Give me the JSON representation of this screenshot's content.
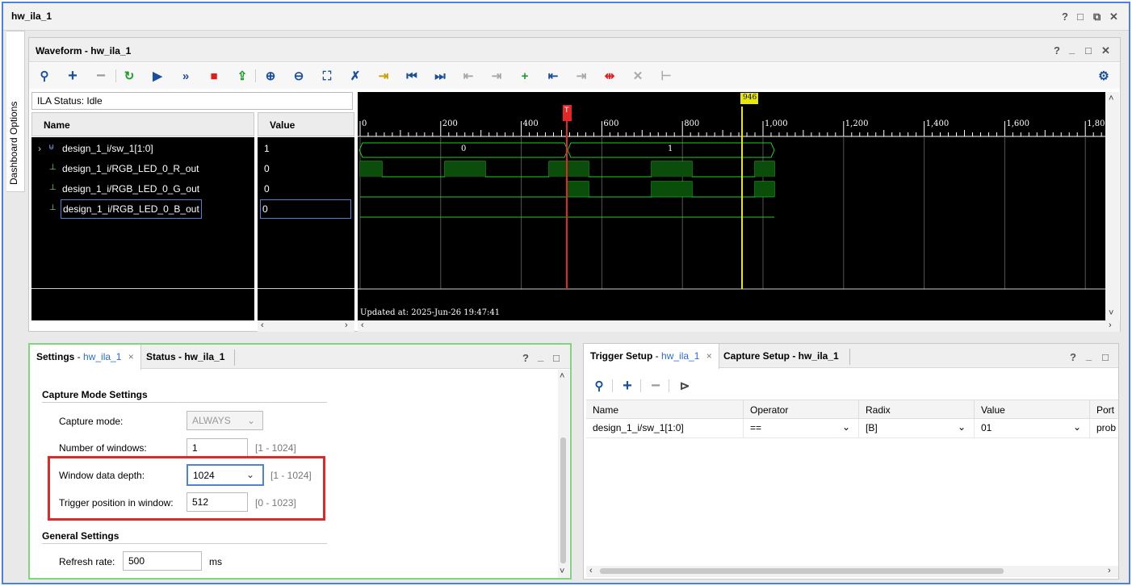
{
  "window": {
    "title": "hw_ila_1",
    "ctl_help": "?",
    "ctl_restore": "□",
    "ctl_float": "⧉",
    "ctl_close": "✕"
  },
  "side_tab": {
    "label": "Dashboard Options"
  },
  "waveform": {
    "title": "Waveform - hw_ila_1",
    "ctl_help": "?",
    "ctl_min": "_",
    "ctl_max": "□",
    "ctl_close": "✕",
    "ila_status": "ILA Status: Idle",
    "col_name": "Name",
    "col_value": "Value",
    "signals": [
      {
        "name": "design_1_i/sw_1[1:0]",
        "value": "1",
        "expand": "›",
        "icon": "bus-icon"
      },
      {
        "name": "design_1_i/RGB_LED_0_R_out",
        "value": "0",
        "icon": "wire-icon"
      },
      {
        "name": "design_1_i/RGB_LED_0_G_out",
        "value": "0",
        "icon": "wire-icon"
      },
      {
        "name": "design_1_i/RGB_LED_0_B_out",
        "value": "0",
        "icon": "wire-icon"
      }
    ],
    "ruler_labels": [
      "0",
      "200",
      "400",
      "600",
      "800",
      "1,000",
      "1,200",
      "1,400",
      "1,600",
      "1,80"
    ],
    "trigger_marker": "T",
    "cursor_label": "946",
    "bus_values": [
      "0",
      "1"
    ],
    "updated": "Updated at: 2025-Jun-26 19:47:41",
    "scroll_left": "‹",
    "scroll_right": "›",
    "scroll_up": "˄",
    "scroll_down": "˅"
  },
  "settings": {
    "tab_active_prefix": "Settings",
    "tab_active_suffix": "hw_ila_1",
    "tab_active_sep": " - ",
    "tab_close": "×",
    "tab_status": "Status - hw_ila_1",
    "ctl_help": "?",
    "ctl_min": "_",
    "ctl_max": "□",
    "capture_heading": "Capture Mode Settings",
    "capture_mode_label": "Capture mode:",
    "capture_mode_value": "ALWAYS",
    "num_windows_label": "Number of windows:",
    "num_windows_value": "1",
    "num_windows_range": "[1 - 1024]",
    "depth_label": "Window data depth:",
    "depth_value": "1024",
    "depth_range": "[1 - 1024]",
    "trigpos_label": "Trigger position in window:",
    "trigpos_value": "512",
    "trigpos_range": "[0 - 1023]",
    "general_heading": "General Settings",
    "refresh_label": "Refresh rate:",
    "refresh_value": "500",
    "refresh_unit": "ms"
  },
  "trigger": {
    "tab_active_prefix": "Trigger Setup",
    "tab_active_sep": " - ",
    "tab_active_suffix": "hw_ila_1",
    "tab_close": "×",
    "tab_capture": "Capture Setup - hw_ila_1",
    "ctl_help": "?",
    "ctl_min": "_",
    "ctl_max": "□",
    "columns": [
      "Name",
      "Operator",
      "Radix",
      "Value",
      "Port"
    ],
    "row": {
      "name": "design_1_i/sw_1[1:0]",
      "operator": "==",
      "radix": "[B]",
      "value": "01",
      "port": "prob"
    }
  },
  "colors": {
    "accent": "#4d82d6",
    "highlight_red": "#e32626",
    "green_border": "#7fd67f",
    "wave": "#22cc22",
    "cursor": "#e8e800"
  }
}
